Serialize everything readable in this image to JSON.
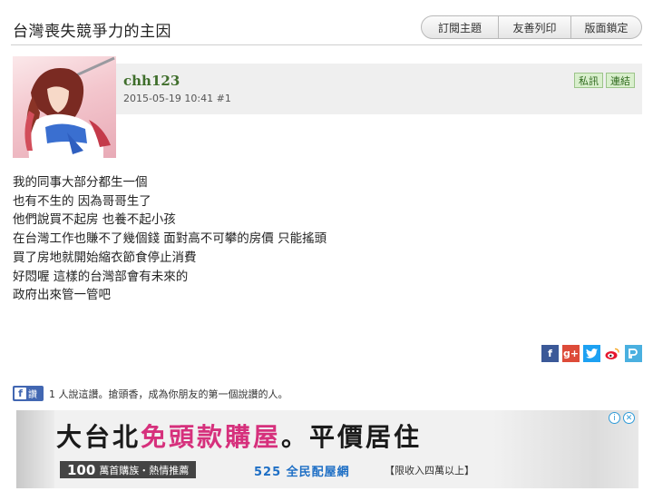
{
  "thread": {
    "title": "台灣喪失競爭力的主因",
    "buttons": {
      "subscribe": "訂閱主題",
      "print": "友善列印",
      "lock": "版面鎖定"
    }
  },
  "post": {
    "username": "chh123",
    "datetime": "2015-05-19 10:41",
    "floor": "#1",
    "pm_label": "私訊",
    "link_label": "連結",
    "lines": [
      "我的同事大部分都生一個",
      "也有不生的 因為哥哥生了",
      "他們說買不起房 也養不起小孩",
      "在台灣工作也賺不了幾個錢 面對高不可攀的房價 只能搖頭",
      "買了房地就開始縮衣節食停止消費",
      "好悶喔 這樣的台灣部會有未來的",
      "政府出來管一管吧"
    ]
  },
  "share": {
    "icons": [
      "facebook-icon",
      "google-plus-icon",
      "twitter-icon",
      "weibo-icon",
      "plurk-icon"
    ],
    "colors": {
      "facebook": "#3b5998",
      "google_plus": "#dd4b39",
      "twitter": "#1da1f2",
      "plurk": "#4ab0e0"
    }
  },
  "facebook_like": {
    "button_label": "讚",
    "text": "1 人說這讚。搶頭香，成為你朋友的第一個說讚的人。"
  },
  "ad": {
    "headline_part1": "大台北",
    "headline_part2": "免頭款購屋",
    "headline_part3": "。平價居住",
    "tag1_number": "100",
    "tag1_text": "萬首購族・熱情推薦",
    "tag2": "525 全民配屋網",
    "tag3": "【限收入四萬以上】"
  }
}
